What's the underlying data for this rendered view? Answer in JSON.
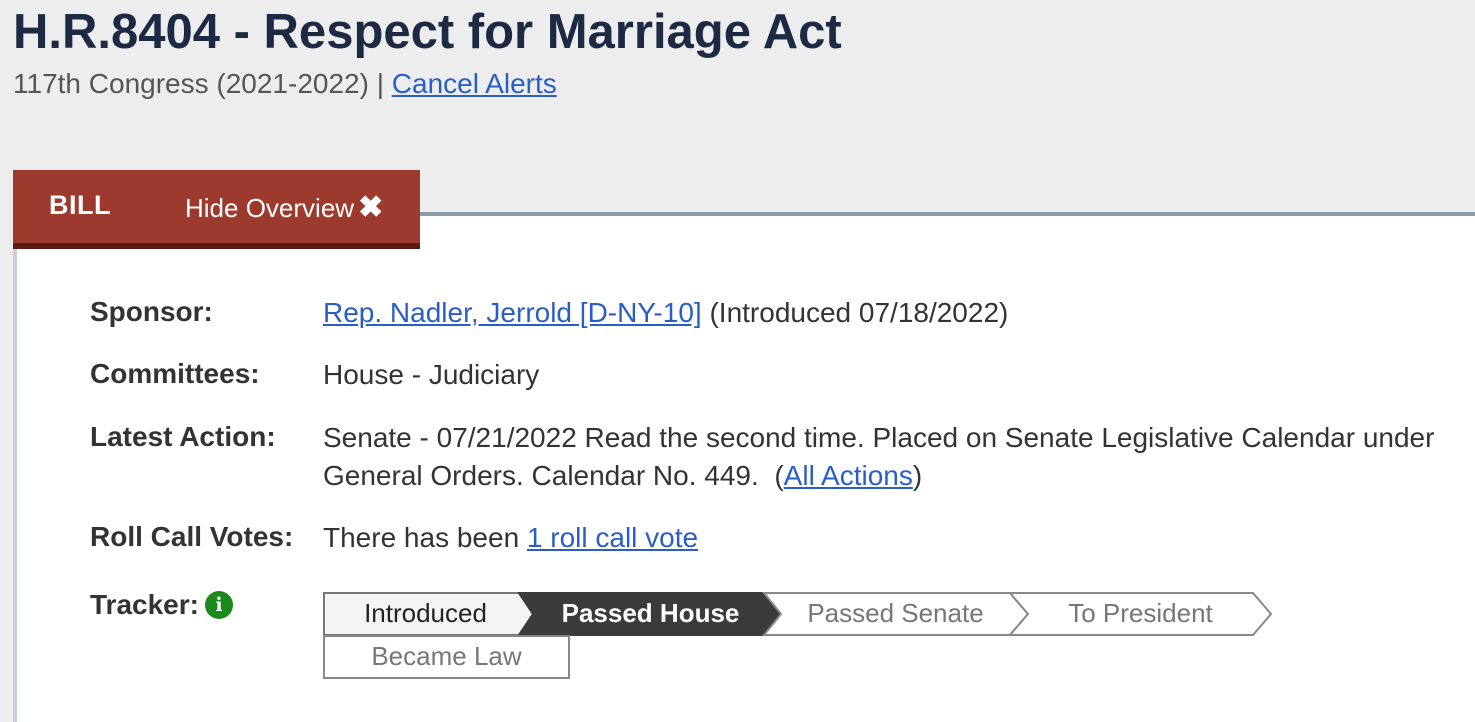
{
  "header": {
    "title": "H.R.8404 - Respect for Marriage Act",
    "congress": "117th Congress (2021-2022) |",
    "cancel_alerts": "Cancel Alerts"
  },
  "tabs": {
    "bill": "BILL",
    "hide_overview": "Hide Overview"
  },
  "overview": {
    "sponsor_label": "Sponsor:",
    "sponsor_link": "Rep. Nadler, Jerrold [D-NY-10]",
    "sponsor_intro": "(Introduced 07/18/2022)",
    "committees_label": "Committees:",
    "committees_value": "House - Judiciary",
    "latest_action_label": "Latest Action:",
    "latest_action_line1": "Senate - 07/21/2022 Read the second time. Placed on Senate Legislative Calendar under",
    "latest_action_line2": "General Orders. Calendar No. 449.  (",
    "all_actions": "All Actions",
    "close_paren": ")",
    "roll_call_label": "Roll Call Votes:",
    "roll_call_prefix": "There has been ",
    "roll_call_link": "1 roll call vote",
    "tracker_label": "Tracker:"
  },
  "tracker": {
    "stages": [
      "Introduced",
      "Passed House",
      "Passed Senate",
      "To President",
      "Became Law"
    ],
    "current_stage": "Passed House"
  },
  "colors": {
    "tab_bg": "#9b3a2d",
    "link": "#2a5ec7",
    "active_stage": "#3b3b3b",
    "info_icon": "#1b8a1b"
  }
}
